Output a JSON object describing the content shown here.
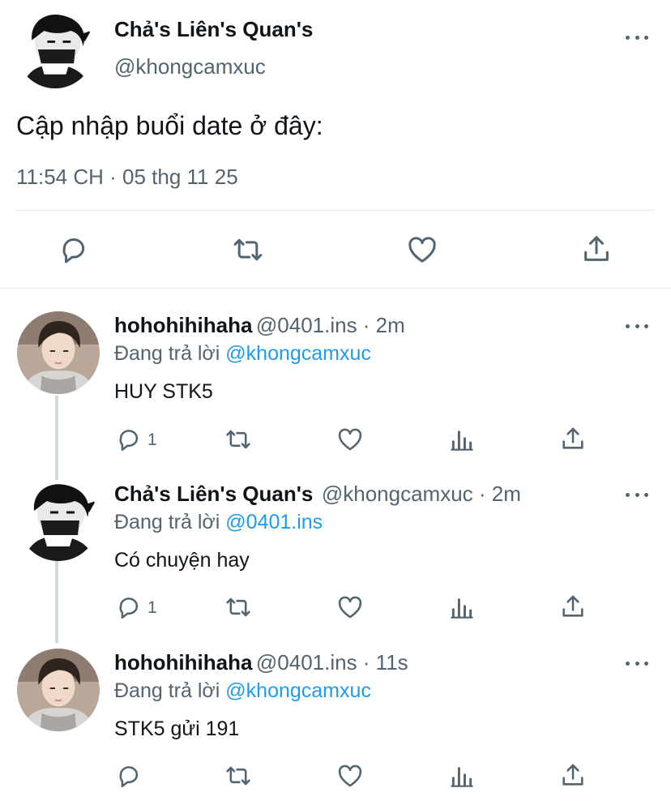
{
  "main_tweet": {
    "display_name": "Chả's Liên's Quan's",
    "handle": "@khongcamxuc",
    "text": "Cập nhập buổi date ở đây:",
    "timestamp": "11:54 CH · 05 thg 11 25"
  },
  "replies": [
    {
      "display_name": "hohohihihaha",
      "meta": "@0401.ins · 2m",
      "reply_prefix": "Đang trả lời ",
      "reply_to": "@khongcamxuc",
      "text": "HUY STK5",
      "reply_count": "1"
    },
    {
      "display_name": "Chả's Liên's Quan's",
      "meta": "@khongcamxuc · 2m",
      "reply_prefix": "Đang trả lời ",
      "reply_to": "@0401.ins",
      "text": "Có chuyện hay",
      "reply_count": "1"
    },
    {
      "display_name": "hohohihihaha",
      "meta": "@0401.ins · 11s",
      "reply_prefix": "Đang trả lời ",
      "reply_to": "@khongcamxuc",
      "text": "STK5 gửi 191",
      "reply_count": ""
    }
  ],
  "colors": {
    "text": "#0f1419",
    "secondary": "#536471",
    "link": "#1d9bf0",
    "divider": "#e1e8ed"
  },
  "icons": [
    "reply-icon",
    "retweet-icon",
    "like-icon",
    "share-icon",
    "views-icon",
    "more-icon"
  ]
}
